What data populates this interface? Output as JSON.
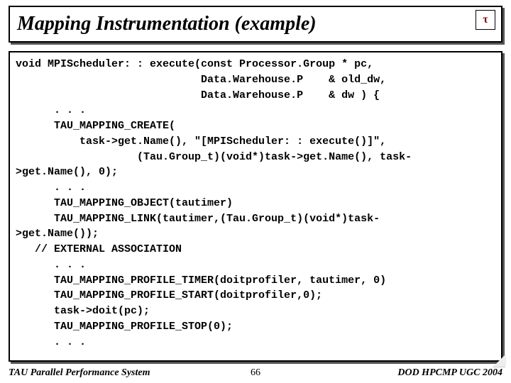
{
  "title": "Mapping Instrumentation (example)",
  "logo_glyph": "τ",
  "code": "void MPIScheduler: : execute(const Processor.Group * pc,\n                             Data.Warehouse.P    & old_dw,\n                             Data.Warehouse.P    & dw ) {\n      . . .\n      TAU_MAPPING_CREATE(\n          task->get.Name(), \"[MPIScheduler: : execute()]\",\n                   (Tau.Group_t)(void*)task->get.Name(), task-\n>get.Name(), 0);\n      . . .\n      TAU_MAPPING_OBJECT(tautimer)\n      TAU_MAPPING_LINK(tautimer,(Tau.Group_t)(void*)task-\n>get.Name());\n   // EXTERNAL ASSOCIATION\n      . . .\n      TAU_MAPPING_PROFILE_TIMER(doitprofiler, tautimer, 0)\n      TAU_MAPPING_PROFILE_START(doitprofiler,0);\n      task->doit(pc);\n      TAU_MAPPING_PROFILE_STOP(0);\n      . . .",
  "footer": {
    "left": "TAU Parallel Performance System",
    "center": "66",
    "right": "DOD HPCMP UGC 2004"
  }
}
